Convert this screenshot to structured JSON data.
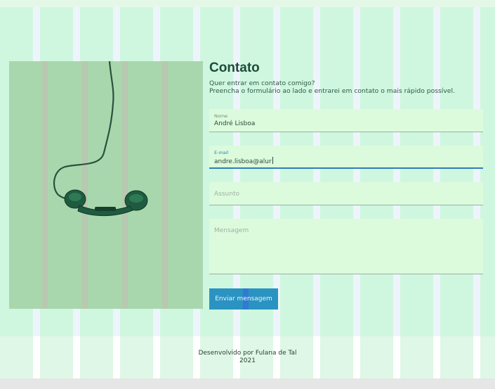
{
  "page": {
    "title": "Contato",
    "subtitle_line1": "Quer entrar em contato comigo?",
    "subtitle_line2": "Preencha o formulário ao lado e entrarei em contato o mais rápido possível."
  },
  "image": {
    "icon": "telephone-handset",
    "alt": ""
  },
  "form": {
    "name": {
      "label": "Nome",
      "value": "André Lisboa"
    },
    "email": {
      "label": "E-mail",
      "value": "andre.lisboa@alur"
    },
    "subject": {
      "placeholder": "Assunto"
    },
    "message": {
      "placeholder": "Mensagem"
    },
    "submit_label": "Enviar mensagem"
  },
  "footer": {
    "line1": "Desenvolvido por Fulana de Tal",
    "line2": "2021"
  },
  "colors": {
    "accent": "#2a93c2",
    "title": "#1f4b3b",
    "field_bg": "#dcfbdc"
  }
}
